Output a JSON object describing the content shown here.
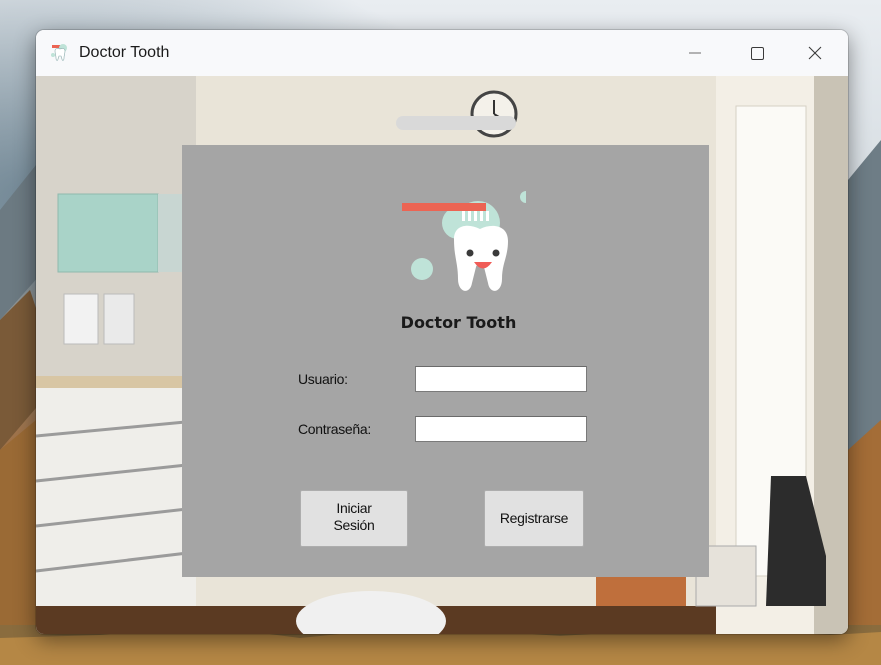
{
  "window": {
    "title": "Doctor Tooth",
    "icon": "tooth-app-icon",
    "controls": [
      "minimize-icon",
      "maximize-icon",
      "close-icon"
    ]
  },
  "login": {
    "logo": "smiling-tooth-toothbrush-logo",
    "app_name": "Doctor Tooth",
    "username_label": "Usuario:",
    "username_value": "",
    "password_label": "Contraseña:",
    "password_value": "",
    "login_button_line1": "Iniciar",
    "login_button_line2": "Sesión",
    "register_button": "Registrarse"
  },
  "colors": {
    "panel": "#a5a5a5",
    "tooth_brush_head": "#ec6453",
    "bubbles": "#bfe3d8",
    "tongue": "#f05c57"
  }
}
